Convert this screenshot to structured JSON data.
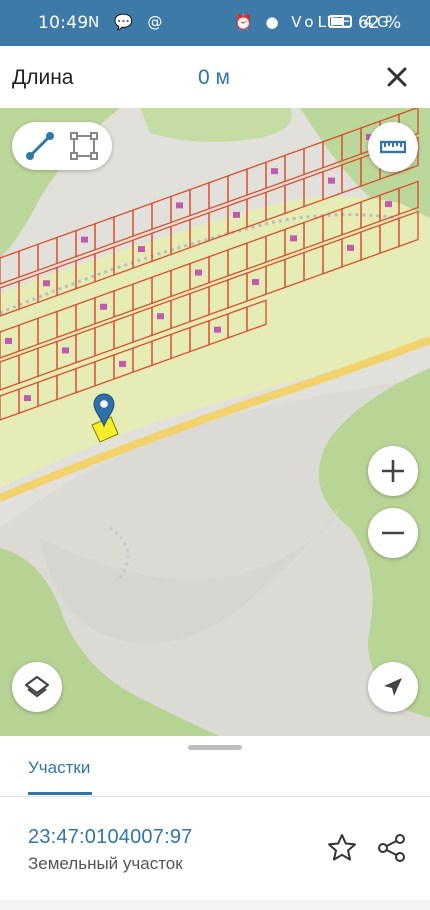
{
  "status_bar": {
    "time": "10:49",
    "left_icons": "N 💬 @",
    "right_icons": "⏰ ● VoLTE 4G",
    "battery": "62 %"
  },
  "top_bar": {
    "title": "Длина",
    "value": "0 м",
    "close_icon": "close-icon"
  },
  "map": {
    "tools": [
      "line-measure-icon",
      "area-measure-icon"
    ],
    "ruler_icon": "ruler-icon",
    "zoom_in_icon": "plus-icon",
    "zoom_out_icon": "minus-icon",
    "layers_icon": "layers-icon",
    "locate_icon": "navigation-arrow-icon",
    "marker_icon": "location-pin-icon",
    "colors": {
      "forest": "#bcd79a",
      "meadow": "#e8edb8",
      "road": "#f3d36e",
      "parcel_border": "#d94f2f",
      "building": "#c45ab0",
      "selected_parcel": "#f5ee2a"
    }
  },
  "sheet": {
    "tab_label": "Участки",
    "cadastral_number": "23:47:0104007:97",
    "parcel_type": "Земельный участок",
    "star_icon": "star-outline-icon",
    "share_icon": "share-icon"
  }
}
